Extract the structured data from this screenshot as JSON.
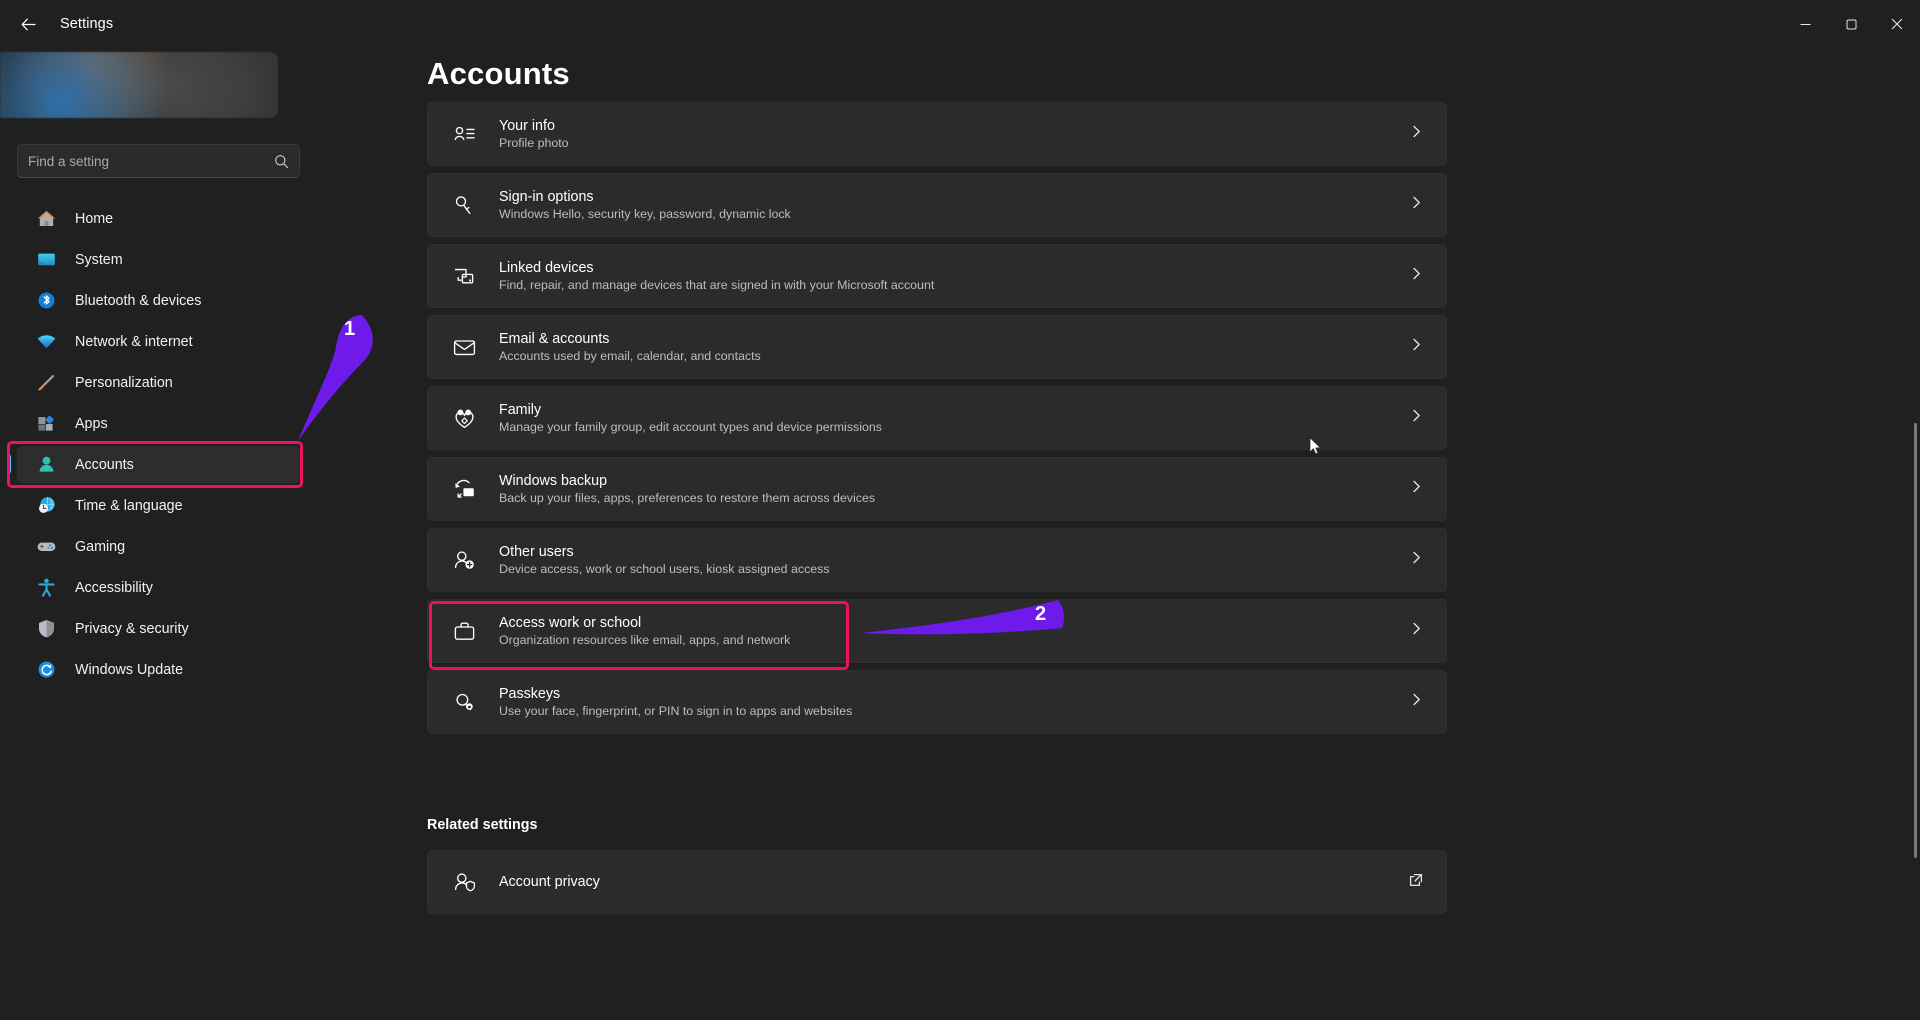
{
  "window": {
    "title": "Settings",
    "back_icon": "back-arrow-icon",
    "minimize_label": "─",
    "maximize_label": "❐",
    "close_label": "✕"
  },
  "sidebar": {
    "search": {
      "placeholder": "Find a setting",
      "value": "",
      "icon": "search-icon"
    },
    "items": [
      {
        "label": "Home",
        "icon": "home-icon",
        "selected": false
      },
      {
        "label": "System",
        "icon": "system-monitor-icon",
        "selected": false
      },
      {
        "label": "Bluetooth & devices",
        "icon": "bluetooth-icon",
        "selected": false
      },
      {
        "label": "Network & internet",
        "icon": "wifi-icon",
        "selected": false
      },
      {
        "label": "Personalization",
        "icon": "paintbrush-icon",
        "selected": false
      },
      {
        "label": "Apps",
        "icon": "apps-icon",
        "selected": false
      },
      {
        "label": "Accounts",
        "icon": "accounts-person-icon",
        "selected": true
      },
      {
        "label": "Time & language",
        "icon": "globe-clock-icon",
        "selected": false
      },
      {
        "label": "Gaming",
        "icon": "gamepad-icon",
        "selected": false
      },
      {
        "label": "Accessibility",
        "icon": "accessibility-person-icon",
        "selected": false
      },
      {
        "label": "Privacy & security",
        "icon": "shield-icon",
        "selected": false
      },
      {
        "label": "Windows Update",
        "icon": "update-refresh-icon",
        "selected": false
      }
    ]
  },
  "main": {
    "page_title": "Accounts",
    "cards": [
      {
        "title": "Your info",
        "sub": "Profile photo",
        "icon": "contact-card-icon"
      },
      {
        "title": "Sign-in options",
        "sub": "Windows Hello, security key, password, dynamic lock",
        "icon": "key-icon"
      },
      {
        "title": "Linked devices",
        "sub": "Find, repair, and manage devices that are signed in with your Microsoft account",
        "icon": "linked-devices-icon"
      },
      {
        "title": "Email & accounts",
        "sub": "Accounts used by email, calendar, and contacts",
        "icon": "envelope-icon"
      },
      {
        "title": "Family",
        "sub": "Manage your family group, edit account types and device permissions",
        "icon": "family-heart-icon"
      },
      {
        "title": "Windows backup",
        "sub": "Back up your files, apps, preferences to restore them across devices",
        "icon": "backup-icon"
      },
      {
        "title": "Other users",
        "sub": "Device access, work or school users, kiosk assigned access",
        "icon": "add-user-icon"
      },
      {
        "title": "Access work or school",
        "sub": "Organization resources like email, apps, and network",
        "icon": "briefcase-icon"
      },
      {
        "title": "Passkeys",
        "sub": "Use your face, fingerprint, or PIN to sign in to apps and websites",
        "icon": "passkey-icon"
      }
    ],
    "related_settings_title": "Related settings",
    "related_cards": [
      {
        "title": "Account privacy",
        "sub": "",
        "icon": "account-privacy-icon"
      }
    ]
  },
  "annotations": {
    "box_color": "#ed1164",
    "arrow_color": "#6d1aeb",
    "markers": [
      {
        "number": "1",
        "target": "Accounts"
      },
      {
        "number": "2",
        "target": "Access work or school"
      }
    ]
  }
}
